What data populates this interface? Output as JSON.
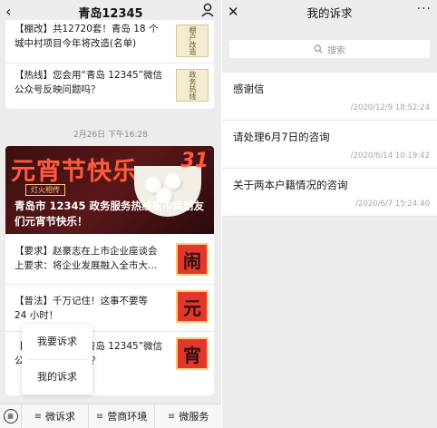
{
  "left": {
    "title": "青岛12345",
    "back_icon": "‹",
    "articles_top": [
      {
        "text": "【棚改】共12720套！青岛 18 个城中村项目今年将改造(名单)",
        "thumb": "棚户改造"
      },
      {
        "text": "【热线】您会用“青岛 12345”微信公众号反映问题吗？",
        "thumb": "政务热线"
      }
    ],
    "timestamp": "2月26日 下午16:28",
    "banner": {
      "headline": "元宵节快乐",
      "caption": "灯火相传",
      "number": "31",
      "title": "青岛市 12345 政务服务热线祝市民朋友们元宵节快乐！"
    },
    "articles_bottom": [
      {
        "text": "【要求】赵豪志在上市企业座谈会上要求：将企业发展融入全市大…",
        "thumb": "闹"
      },
      {
        "text": "【普法】千万记住！这事不要等 24 小时！",
        "thumb": "元"
      },
      {
        "text": "【热线】您会用“青岛 12345”微信公众号反映问题吗？",
        "thumb": "宵"
      }
    ],
    "popup": [
      "我要诉求",
      "我的诉求"
    ],
    "menu": [
      "微诉求",
      "营商环境",
      "微服务"
    ]
  },
  "right": {
    "title": "我的诉求",
    "close_icon": "✕",
    "more_icon": "···",
    "search_placeholder": "搜索",
    "items": [
      {
        "title": "感谢信",
        "time": "/2020/12/9 18:52:24"
      },
      {
        "title": "请处理6月7日的咨询",
        "time": "/2020/6/14 10:19:42"
      },
      {
        "title": "关于两本户籍情况的咨询",
        "time": "/2020/6/7 15:24:40"
      }
    ]
  },
  "colors": {
    "accent_red": "#e3372c",
    "banner_text": "#ff5a3c",
    "background": "#ededed"
  }
}
